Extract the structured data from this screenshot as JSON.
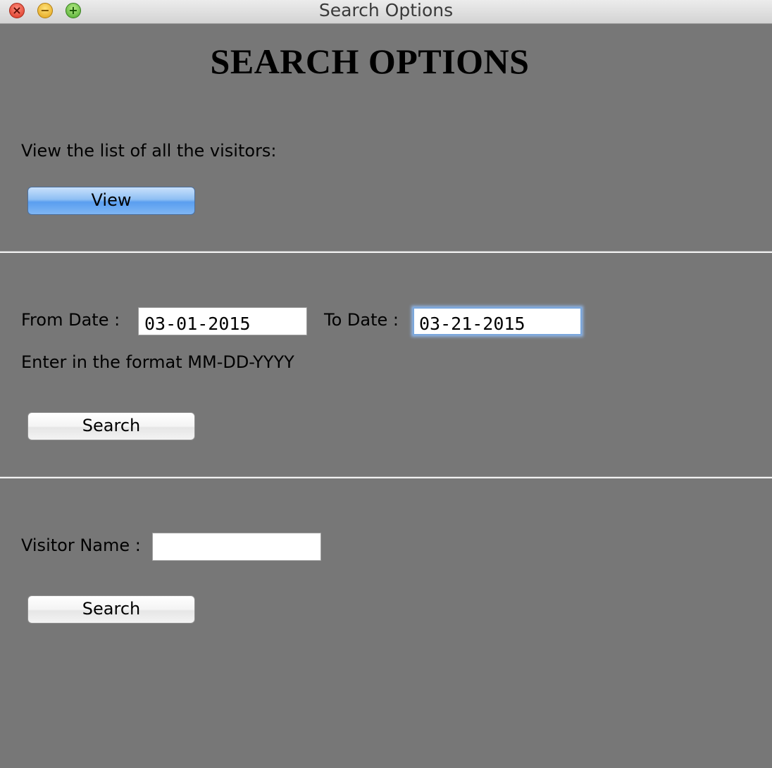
{
  "window": {
    "title": "Search Options",
    "controls": {
      "close_glyph": "×",
      "minimize_glyph": "−",
      "zoom_glyph": "+"
    }
  },
  "heading": "SEARCH OPTIONS",
  "view_section": {
    "label": "View the list of all the visitors:",
    "button_label": "View"
  },
  "date_section": {
    "from_label": "From Date :",
    "from_value": "03-01-2015",
    "to_label": "To Date :",
    "to_value": "03-21-2015",
    "format_hint": "Enter in the format MM-DD-YYYY",
    "search_label": "Search"
  },
  "name_section": {
    "label": "Visitor Name :",
    "value": "",
    "search_label": "Search"
  },
  "colors": {
    "background": "#777777",
    "primary_button": "#5a9ef0",
    "focus_ring": "#7aa7dc"
  }
}
